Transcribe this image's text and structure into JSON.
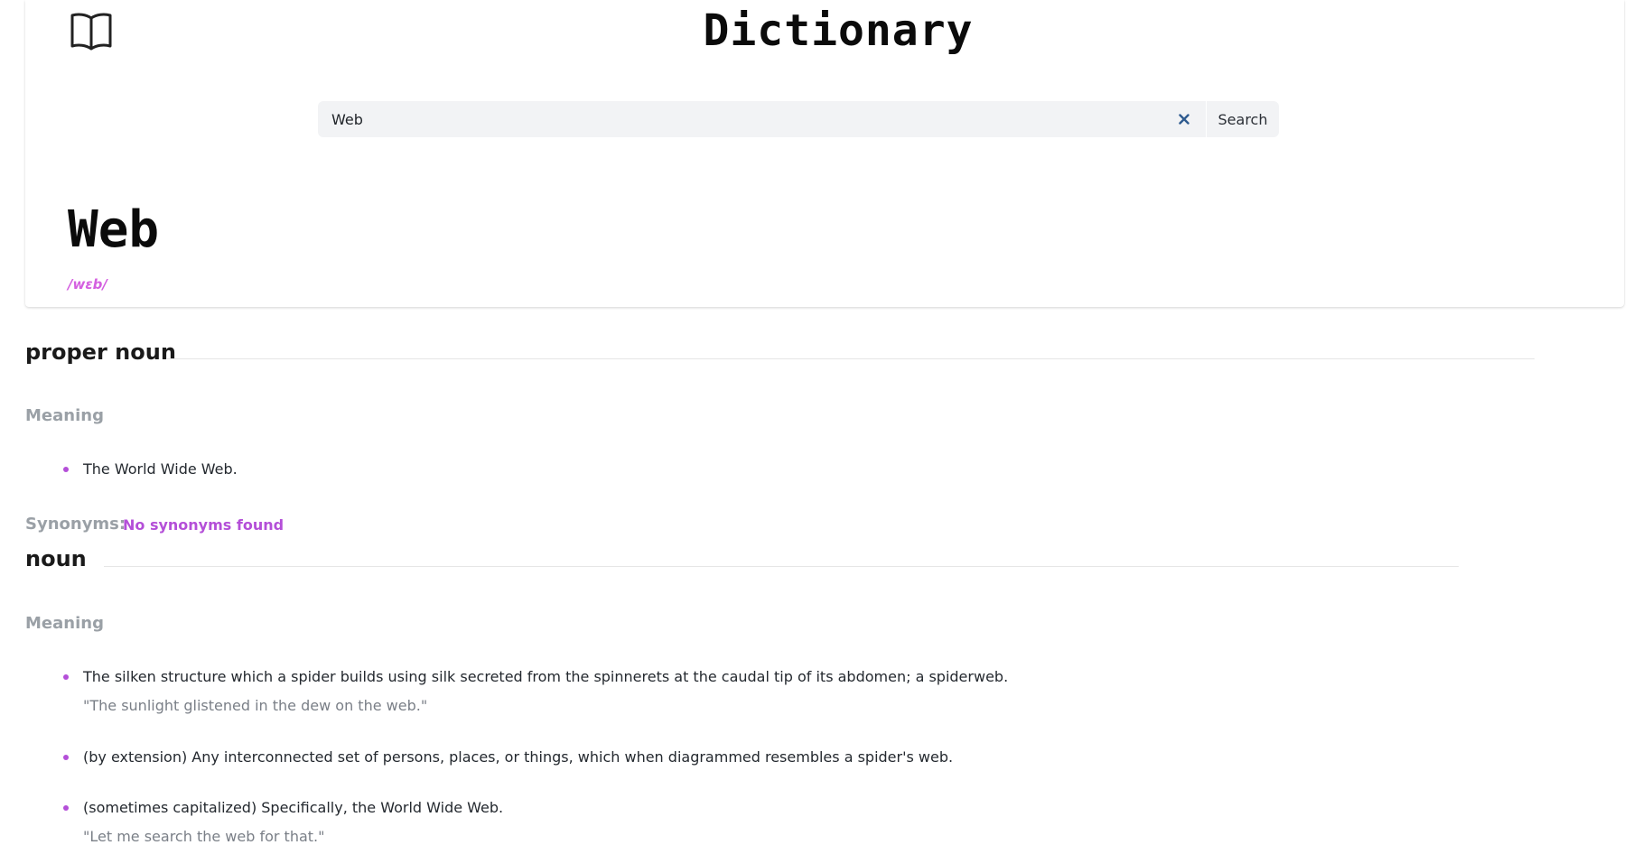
{
  "app": {
    "title": "Dictionary"
  },
  "search": {
    "value": "Web",
    "button_label": "Search"
  },
  "entry": {
    "word": "Web",
    "phonetic": "/wɛb/"
  },
  "sections": [
    {
      "part_of_speech": "proper noun",
      "meaning_label": "Meaning",
      "definitions": [
        {
          "text": "The World Wide Web.",
          "example": ""
        }
      ],
      "synonyms_label": "Synonyms:",
      "synonyms_value": "No synonyms found"
    },
    {
      "part_of_speech": "noun",
      "meaning_label": "Meaning",
      "definitions": [
        {
          "text": "The silken structure which a spider builds using silk secreted from the spinnerets at the caudal tip of its abdomen; a spiderweb.",
          "example": "\"The sunlight glistened in the dew on the web.\""
        },
        {
          "text": "(by extension) Any interconnected set of persons, places, or things, which when diagrammed resembles a spider's web.",
          "example": ""
        },
        {
          "text": "(sometimes capitalized) Specifically, the World Wide Web.",
          "example": "\"Let me search the web for that.\""
        }
      ]
    }
  ],
  "colors": {
    "accent": "#b44fd8",
    "phonetic": "#d45fe0",
    "muted": "#9aa0a6",
    "clear_icon": "#2e5a8f"
  },
  "icons": {
    "logo": "open-book-icon",
    "clear": "close-icon"
  }
}
